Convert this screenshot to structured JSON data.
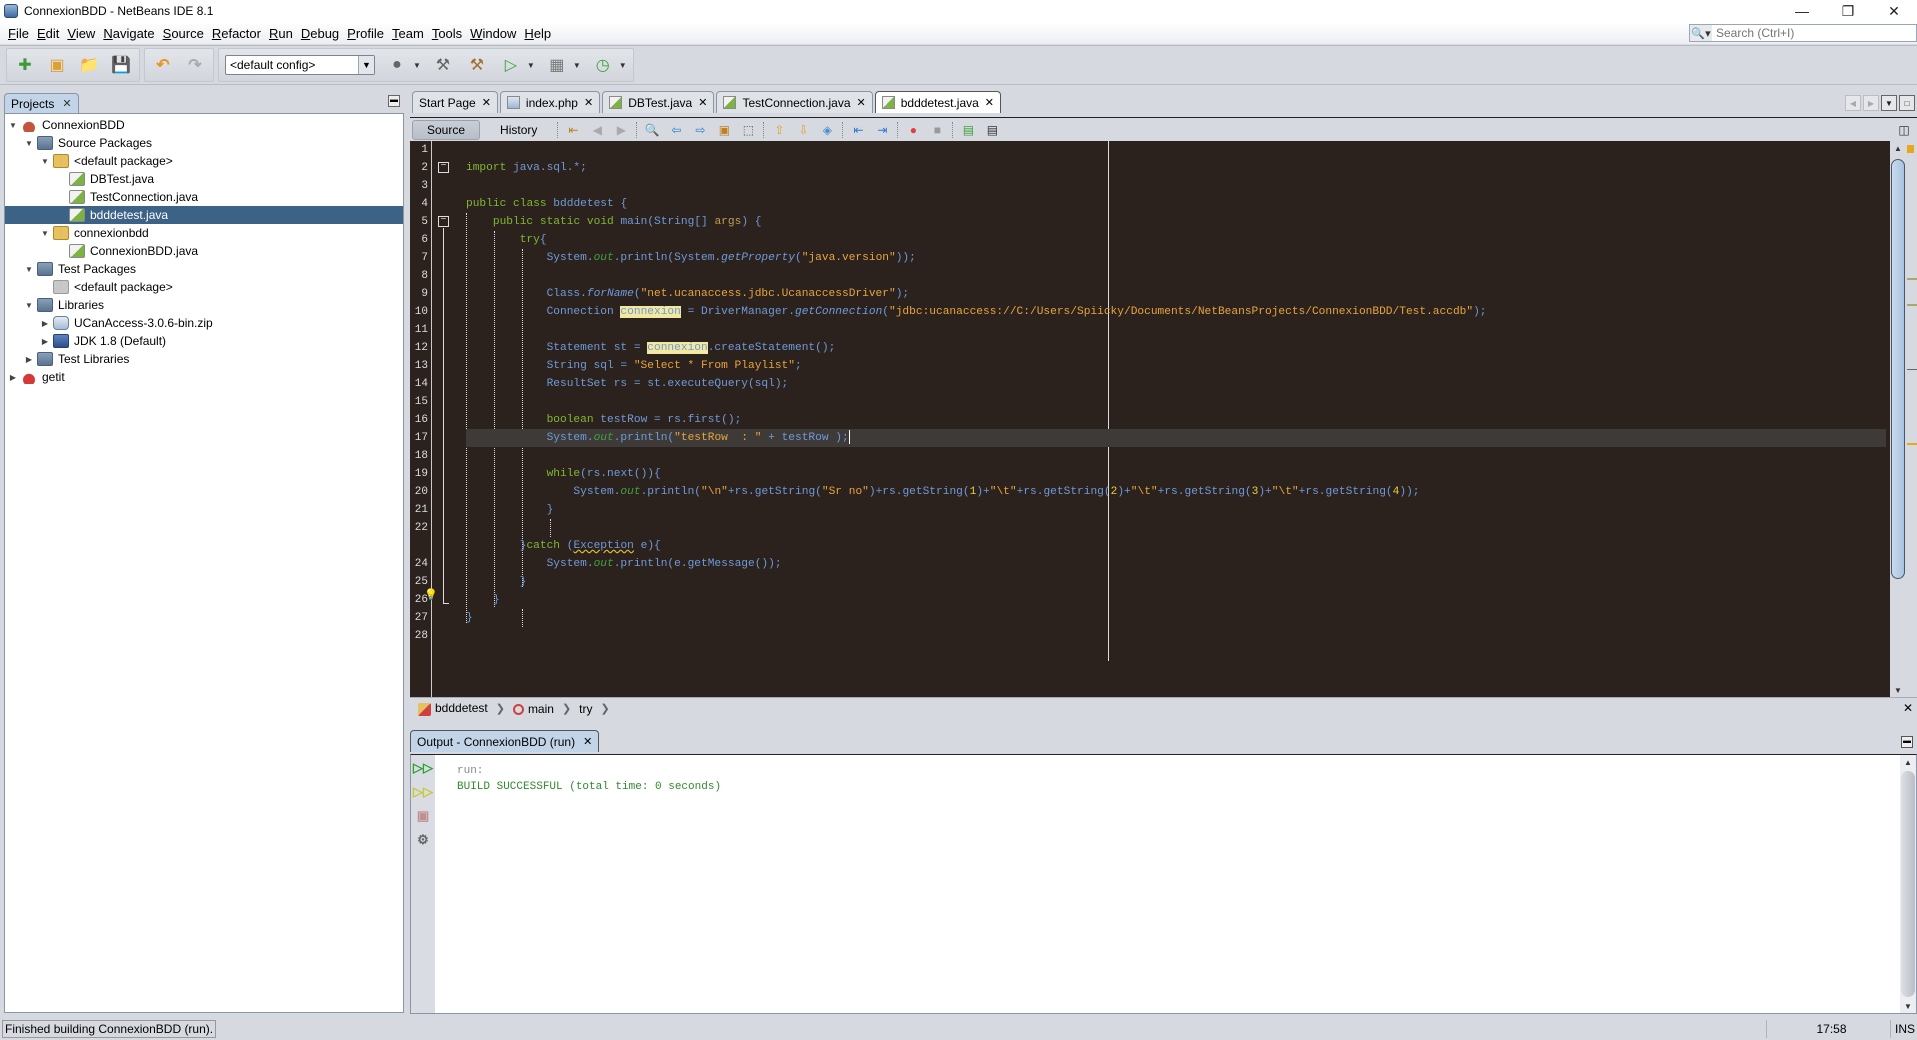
{
  "window": {
    "title": "ConnexionBDD - NetBeans IDE 8.1",
    "minimize": "—",
    "restore": "❐",
    "close": "✕"
  },
  "menu": [
    "File",
    "Edit",
    "View",
    "Navigate",
    "Source",
    "Refactor",
    "Run",
    "Debug",
    "Profile",
    "Team",
    "Tools",
    "Window",
    "Help"
  ],
  "search": {
    "placeholder": "Search (Ctrl+I)",
    "icon": "search-icon"
  },
  "toolbar": {
    "config_selected": "<default config>",
    "buttons": [
      "new-file",
      "new-project",
      "open-project",
      "save-all",
      "undo",
      "redo",
      "browser",
      "build",
      "clean-build",
      "run",
      "debug",
      "profile"
    ]
  },
  "projects_panel": {
    "tab_label": "Projects",
    "tree": [
      {
        "label": "ConnexionBDD",
        "depth": 0,
        "expanded": true,
        "icon": "project-icon"
      },
      {
        "label": "Source Packages",
        "depth": 1,
        "expanded": true,
        "icon": "source-packages-icon"
      },
      {
        "label": "<default package>",
        "depth": 2,
        "expanded": true,
        "icon": "package-icon"
      },
      {
        "label": "DBTest.java",
        "depth": 3,
        "icon": "java-file-icon"
      },
      {
        "label": "TestConnection.java",
        "depth": 3,
        "icon": "java-file-icon"
      },
      {
        "label": "bdddetest.java",
        "depth": 3,
        "icon": "java-file-icon",
        "selected": true
      },
      {
        "label": "connexionbdd",
        "depth": 2,
        "expanded": true,
        "icon": "package-icon"
      },
      {
        "label": "ConnexionBDD.java",
        "depth": 3,
        "icon": "java-file-icon"
      },
      {
        "label": "Test Packages",
        "depth": 1,
        "expanded": true,
        "icon": "test-packages-icon"
      },
      {
        "label": "<default package>",
        "depth": 2,
        "icon": "empty-package-icon"
      },
      {
        "label": "Libraries",
        "depth": 1,
        "expanded": true,
        "icon": "libraries-icon"
      },
      {
        "label": "UCanAccess-3.0.6-bin.zip",
        "depth": 2,
        "expanded": false,
        "icon": "jar-icon"
      },
      {
        "label": "JDK 1.8 (Default)",
        "depth": 2,
        "expanded": false,
        "icon": "jdk-icon"
      },
      {
        "label": "Test Libraries",
        "depth": 1,
        "expanded": false,
        "icon": "test-libraries-icon"
      },
      {
        "label": "getit",
        "depth": 0,
        "expanded": false,
        "icon": "project-error-icon"
      }
    ]
  },
  "editor": {
    "tabs": [
      {
        "label": "Start Page",
        "active": false
      },
      {
        "label": "index.php",
        "active": false
      },
      {
        "label": "DBTest.java",
        "active": false
      },
      {
        "label": "TestConnection.java",
        "active": false
      },
      {
        "label": "bdddetest.java",
        "active": true
      }
    ],
    "source_label": "Source",
    "history_label": "History",
    "current_line": 17,
    "code_lines": [
      "",
      "import java.sql.*;",
      "",
      "public class bdddetest {",
      "    public static void main(String[] args) {",
      "        try{",
      "            System.out.println(System.getProperty(\"java.version\"));",
      "",
      "            Class.forName(\"net.ucanaccess.jdbc.UcanaccessDriver\");",
      "            Connection connexion = DriverManager.getConnection(\"jdbc:ucanaccess://C:/Users/Spiicky/Documents/NetBeansProjects/ConnexionBDD/Test.accdb\");",
      "",
      "            Statement st = connexion.createStatement();",
      "            String sql = \"Select * From Playlist\";",
      "            ResultSet rs = st.executeQuery(sql);",
      "",
      "            boolean testRow = rs.first();",
      "            System.out.println(\"testRow  : \" + testRow );",
      "",
      "            while(rs.next()){",
      "                System.out.println(\"\\n\"+rs.getString(\"Sr no\")+rs.getString(1)+\"\\t\"+rs.getString(2)+\"\\t\"+rs.getString(3)+\"\\t\"+rs.getString(4));",
      "            }",
      "",
      "        }catch (Exception e){",
      "            System.out.println(e.getMessage());",
      "        }",
      "    }",
      "}",
      ""
    ],
    "breadcrumb": [
      "bdddetest",
      "main",
      "try"
    ]
  },
  "output": {
    "tab_label": "Output - ConnexionBDD (run)",
    "lines": [
      {
        "text": "run:",
        "color": "#888888"
      },
      {
        "text": "BUILD SUCCESSFUL (total time: 0 seconds)",
        "color": "#2e8b2e"
      }
    ]
  },
  "status": {
    "message": "Finished building ConnexionBDD (run).",
    "position": "17:58",
    "mode": "INS"
  },
  "colors": {
    "editor_bg": "#2b221e",
    "keyword": "#7fb830",
    "identifier": "#6f9ad8",
    "string": "#e8a43c",
    "selection": "#3c6286"
  }
}
